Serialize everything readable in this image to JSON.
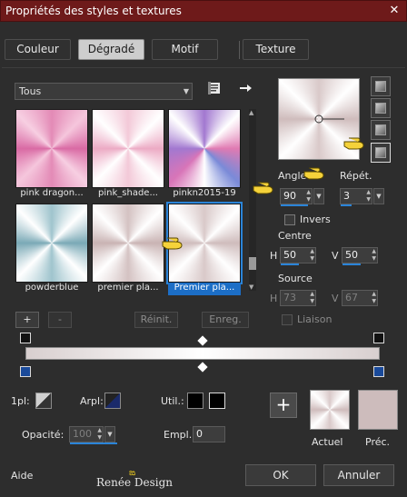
{
  "window": {
    "title": "Propriétés des styles et textures",
    "close_glyph": "✕"
  },
  "tabs": [
    {
      "label": "Couleur",
      "active": false
    },
    {
      "label": "Dégradé",
      "active": true
    },
    {
      "label": "Motif",
      "active": false
    },
    {
      "label": "Texture",
      "active": false
    }
  ],
  "category_dropdown": {
    "value": "Tous"
  },
  "toolbar_icons": {
    "book": "book-icon",
    "arrow": "arrow-right-icon"
  },
  "gradients": [
    {
      "label": "pink dragon...",
      "css": "conic-gradient(from 0deg at 50% 50%, #e38ab6, #f5c6dc, #d96aa4, #f7cfe2, #e38ab6, #f5c6dc, #d96aa4, #f7cfe2, #e38ab6)"
    },
    {
      "label": "pink_shade...",
      "css": "conic-gradient(from 0deg at 50% 50%, #f3c9d8, #ffffff, #ecaac4, #ffffff, #f3c9d8, #ffffff, #ecaac4, #ffffff, #f3c9d8)"
    },
    {
      "label": "pinkn2015-19",
      "css": "conic-gradient(from 0deg at 50% 50%, #a278d0, #ffffff, #e07ab2, #7a8ad8, #ffffff, #d875b8, #a278d0, #ffffff, #a278d0)"
    },
    {
      "label": "powderblue",
      "css": "conic-gradient(from 0deg at 50% 50%, #9fc4cd, #ffffff, #7aa9b6, #ffffff, #9fc4cd, #ffffff, #7aa9b6, #ffffff, #9fc4cd)"
    },
    {
      "label": "premier pla...",
      "css": "conic-gradient(from 0deg at 50% 50%, #d4c2c2, #ffffff, #c9b3b3, #ffffff, #d4c2c2, #ffffff, #c9b3b3, #ffffff, #d4c2c2)"
    },
    {
      "label": "Premier pla...",
      "css": "conic-gradient(from 0deg at 50% 50%, #d9c9c9, #ffffff, #cfbcbc, #ffffff, #d9c9c9, #ffffff, #cfbcbc, #ffffff, #d9c9c9)",
      "selected": true
    }
  ],
  "buttons": {
    "add": "+",
    "remove": "-",
    "reset": "Réinit.",
    "save": "Enreg."
  },
  "params": {
    "angle_label": "Angle",
    "angle_value": "90",
    "repeat_label": "Répét.",
    "repeat_value": "3",
    "invert_label": "Invers",
    "center_label": "Centre",
    "center_h_label": "H",
    "center_h": "50",
    "center_v_label": "V",
    "center_v": "50",
    "source_label": "Source",
    "source_h_label": "H",
    "source_h": "73",
    "source_v_label": "V",
    "source_v": "67",
    "link_label": "Liaison"
  },
  "editor": {
    "pl_label": "1pl:",
    "arpl_label": "Arpl:",
    "util_label": "Util.:",
    "opacity_label": "Opacité:",
    "opacity_value": "100",
    "empl_label": "Empl.:",
    "empl_value": "0"
  },
  "swatches": {
    "current_label": "Actuel",
    "previous_label": "Préc.",
    "plus": "+"
  },
  "footer": {
    "help": "Aide",
    "watermark": "Renée Design",
    "ok": "OK",
    "cancel": "Annuler"
  },
  "colors": {
    "title_bar": "#6e1a1a",
    "accent": "#2a84d8",
    "prev_swatch": "#cdbcbc"
  }
}
